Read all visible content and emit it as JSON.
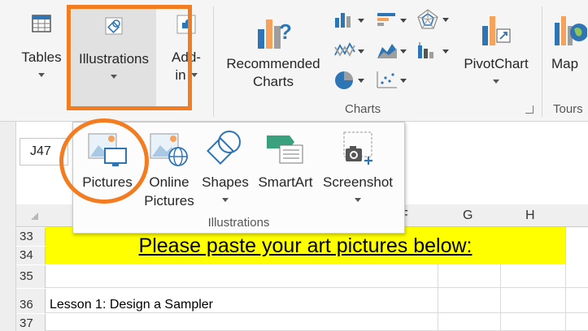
{
  "ribbon": {
    "tables_label": "Tables",
    "illustrations_label": "Illustrations",
    "addins_label_1": "Add-",
    "addins_label_2": "in",
    "recommended_charts_label_1": "Recommended",
    "recommended_charts_label_2": "Charts",
    "pivotchart_label": "PivotChart",
    "maps_label": "Map",
    "charts_group_label": "Charts",
    "tours_group_label": "Tours"
  },
  "dropdown": {
    "items": [
      {
        "label_1": "Pictures",
        "label_2": ""
      },
      {
        "label_1": "Online",
        "label_2": "Pictures"
      },
      {
        "label_1": "Shapes",
        "label_2": ""
      },
      {
        "label_1": "SmartArt",
        "label_2": ""
      },
      {
        "label_1": "Screenshot",
        "label_2": ""
      }
    ],
    "group_label": "Illustrations"
  },
  "sheet": {
    "name_box": "J47",
    "columns": [
      "F",
      "G",
      "H"
    ],
    "rows": [
      "33",
      "34",
      "35",
      "36",
      "37"
    ],
    "banner_text": "Please paste your art pictures below:",
    "lesson_text": "Lesson 1:  Design a Sampler"
  },
  "colors": {
    "highlight": "#f47c20",
    "banner_fill": "#ffff00",
    "icon_blue": "#2e75b6",
    "icon_orange": "#f5a25d"
  }
}
